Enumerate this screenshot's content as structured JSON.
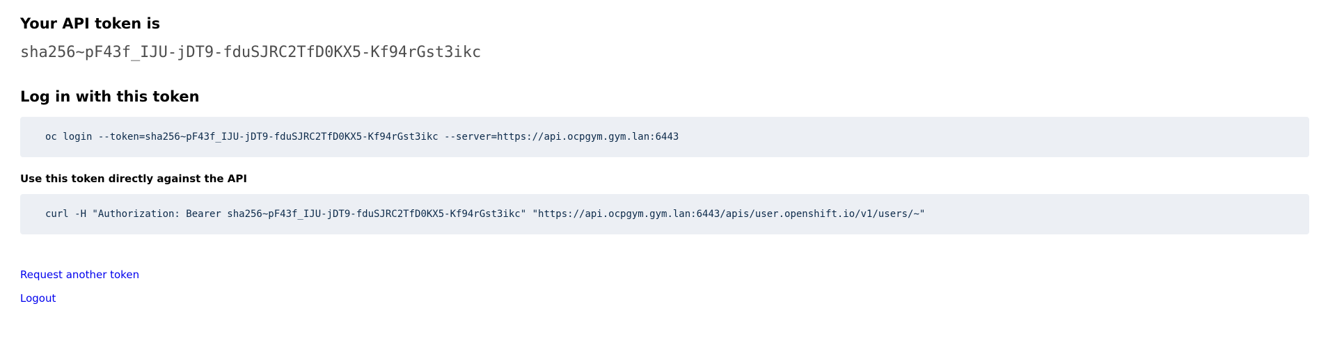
{
  "token_section": {
    "heading": "Your API token is",
    "token": "sha256~pF43f_IJU-jDT9-fduSJRC2TfD0KX5-Kf94rGst3ikc"
  },
  "login_section": {
    "heading": "Log in with this token",
    "command": "oc login --token=sha256~pF43f_IJU-jDT9-fduSJRC2TfD0KX5-Kf94rGst3ikc --server=https://api.ocpgym.gym.lan:6443"
  },
  "api_section": {
    "heading": "Use this token directly against the API",
    "command": "curl -H \"Authorization: Bearer sha256~pF43f_IJU-jDT9-fduSJRC2TfD0KX5-Kf94rGst3ikc\" \"https://api.ocpgym.gym.lan:6443/apis/user.openshift.io/v1/users/~\""
  },
  "links": {
    "request_another": "Request another token",
    "logout": "Logout"
  },
  "colors": {
    "link": "#0000ee",
    "code_background": "#eceff4",
    "code_text": "#0c2a4a"
  }
}
